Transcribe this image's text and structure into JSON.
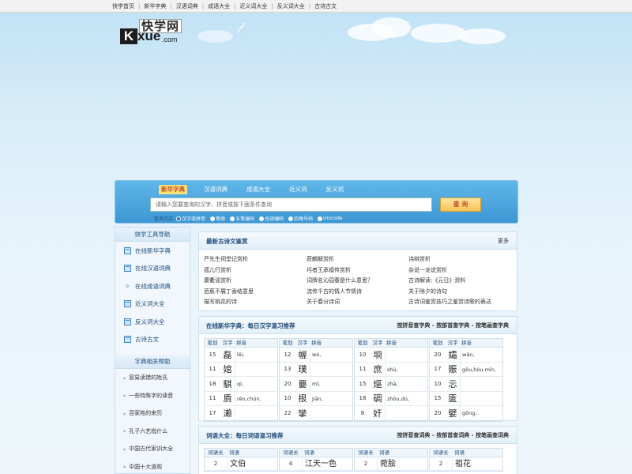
{
  "topnav": [
    "快学首页",
    "新华字典",
    "汉语词典",
    "成语大全",
    "近义词大全",
    "反义词大全",
    "古诗古文"
  ],
  "logo": {
    "cn": "快学网",
    "k": "K",
    "xue": "xue",
    "com": ".com"
  },
  "search": {
    "tabs": [
      "新华字典",
      "汉语词典",
      "成语大全",
      "近义词",
      "反义词"
    ],
    "placeholder": "请输入您要查询的汉字、拼音或按下面条件查询",
    "button": "查 询",
    "method_label": "查询方式:",
    "methods": [
      "汉字或拼音",
      "笔顺",
      "五笔编码",
      "仓颉编码",
      "四角号码",
      "Unicode"
    ]
  },
  "sidebar": {
    "title": "快学工具导航",
    "items": [
      "在线新华字典",
      "在线汉语词典",
      "在线成语词典",
      "近义词大全",
      "反义词大全",
      "古诗古文"
    ],
    "help_title": "字典相关帮助",
    "help_items": [
      "容易读错的姓氏",
      "一些特殊字的读音",
      "百家姓的来历",
      "孔子六艺指什么",
      "中国古代家训大全",
      "中国十大道观"
    ]
  },
  "poems": {
    "title": "最新古诗文鉴赏",
    "more": "更多",
    "items": [
      "严先生祠堂记赏析",
      "获麟解赏析",
      "讳辩赏析",
      "孤儿行赏析",
      "圬者王承福传赏析",
      "杂说一龙说赏析",
      "康衢谣赏析",
      "词牌名沁园春是什么意思？",
      "古诗解读:《元日》资料",
      "芭蕉不展丁香结意思",
      "流传千古的情人节情诗",
      "关于除夕的诗句",
      "描写桃花的诗",
      "关于春分诗词",
      "古诗词鉴赏技巧之鉴赏诗歌的表达"
    ]
  },
  "dict": {
    "title": "在线新华字典：每日汉字温习推荐",
    "links": "按拼音查字典 - 按部首查字典 - 按笔画查字典",
    "head": {
      "bh": "笔划",
      "zi": "汉字",
      "py": "拼音"
    },
    "columns": [
      [
        {
          "bh": "15",
          "zi": "磊",
          "py": "lěi,"
        },
        {
          "bh": "11",
          "zi": "婠",
          "py": ""
        },
        {
          "bh": "18",
          "zi": "騏",
          "py": "qí,"
        },
        {
          "bh": "11",
          "zi": "貭",
          "py": "rěn,chún,"
        },
        {
          "bh": "17",
          "zi": "濑",
          "py": ""
        }
      ],
      [
        {
          "bh": "12",
          "zi": "幄",
          "py": "wò,"
        },
        {
          "bh": "13",
          "zi": "璞",
          "py": ""
        },
        {
          "bh": "20",
          "zi": "蘡",
          "py": "mǐ,"
        },
        {
          "bh": "10",
          "zi": "拫",
          "py": "jiān,"
        },
        {
          "bh": "22",
          "zi": "攣",
          "py": ""
        }
      ],
      [
        {
          "bh": "10",
          "zi": "埛",
          "py": ""
        },
        {
          "bh": "11",
          "zi": "庶",
          "py": "shù,"
        },
        {
          "bh": "15",
          "zi": "熰",
          "py": "zhá,"
        },
        {
          "bh": "18",
          "zi": "碉",
          "py": "zhōu,dú,"
        },
        {
          "bh": "8",
          "zi": "奸",
          "py": ""
        }
      ],
      [
        {
          "bh": "20",
          "zi": "孀",
          "py": "wān,"
        },
        {
          "bh": "17",
          "zi": "賑",
          "py": "gōu,hóu,mǐn,"
        },
        {
          "bh": "10",
          "zi": "忈",
          "py": ""
        },
        {
          "bh": "15",
          "zi": "匳",
          "py": ""
        },
        {
          "bh": "20",
          "zi": "嬖",
          "py": "gōng,"
        }
      ]
    ]
  },
  "words": {
    "title": "词语大全：每日词语温习推荐",
    "links": "按拼音查词典 - 按部首查词典 - 按笔画查词典",
    "head": {
      "len": "词语长",
      "w": "词语"
    },
    "columns": [
      [
        {
          "len": "2",
          "w": "文伯"
        }
      ],
      [
        {
          "len": "4",
          "w": "江天一色"
        }
      ],
      [
        {
          "len": "2",
          "w": "菀脍"
        }
      ],
      [
        {
          "len": "2",
          "w": "祖花"
        }
      ]
    ]
  }
}
